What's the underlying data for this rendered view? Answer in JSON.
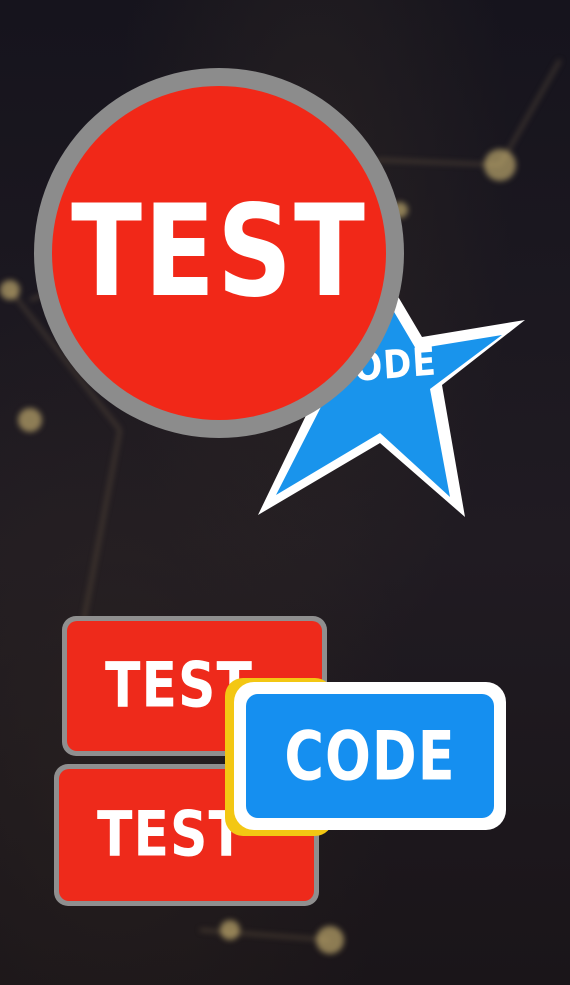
{
  "circle_badge": {
    "label": "TEST"
  },
  "star_badge": {
    "label": "ODE"
  },
  "buttons": {
    "top": {
      "label": "TEST"
    },
    "bottom": {
      "label": "TEST"
    },
    "code": {
      "label": "CODE"
    }
  },
  "colors": {
    "red": "#f12818",
    "blue": "#158ff0",
    "yellow": "#f3c713",
    "gray_border": "#8c8c8c",
    "background": "#1b1822"
  }
}
